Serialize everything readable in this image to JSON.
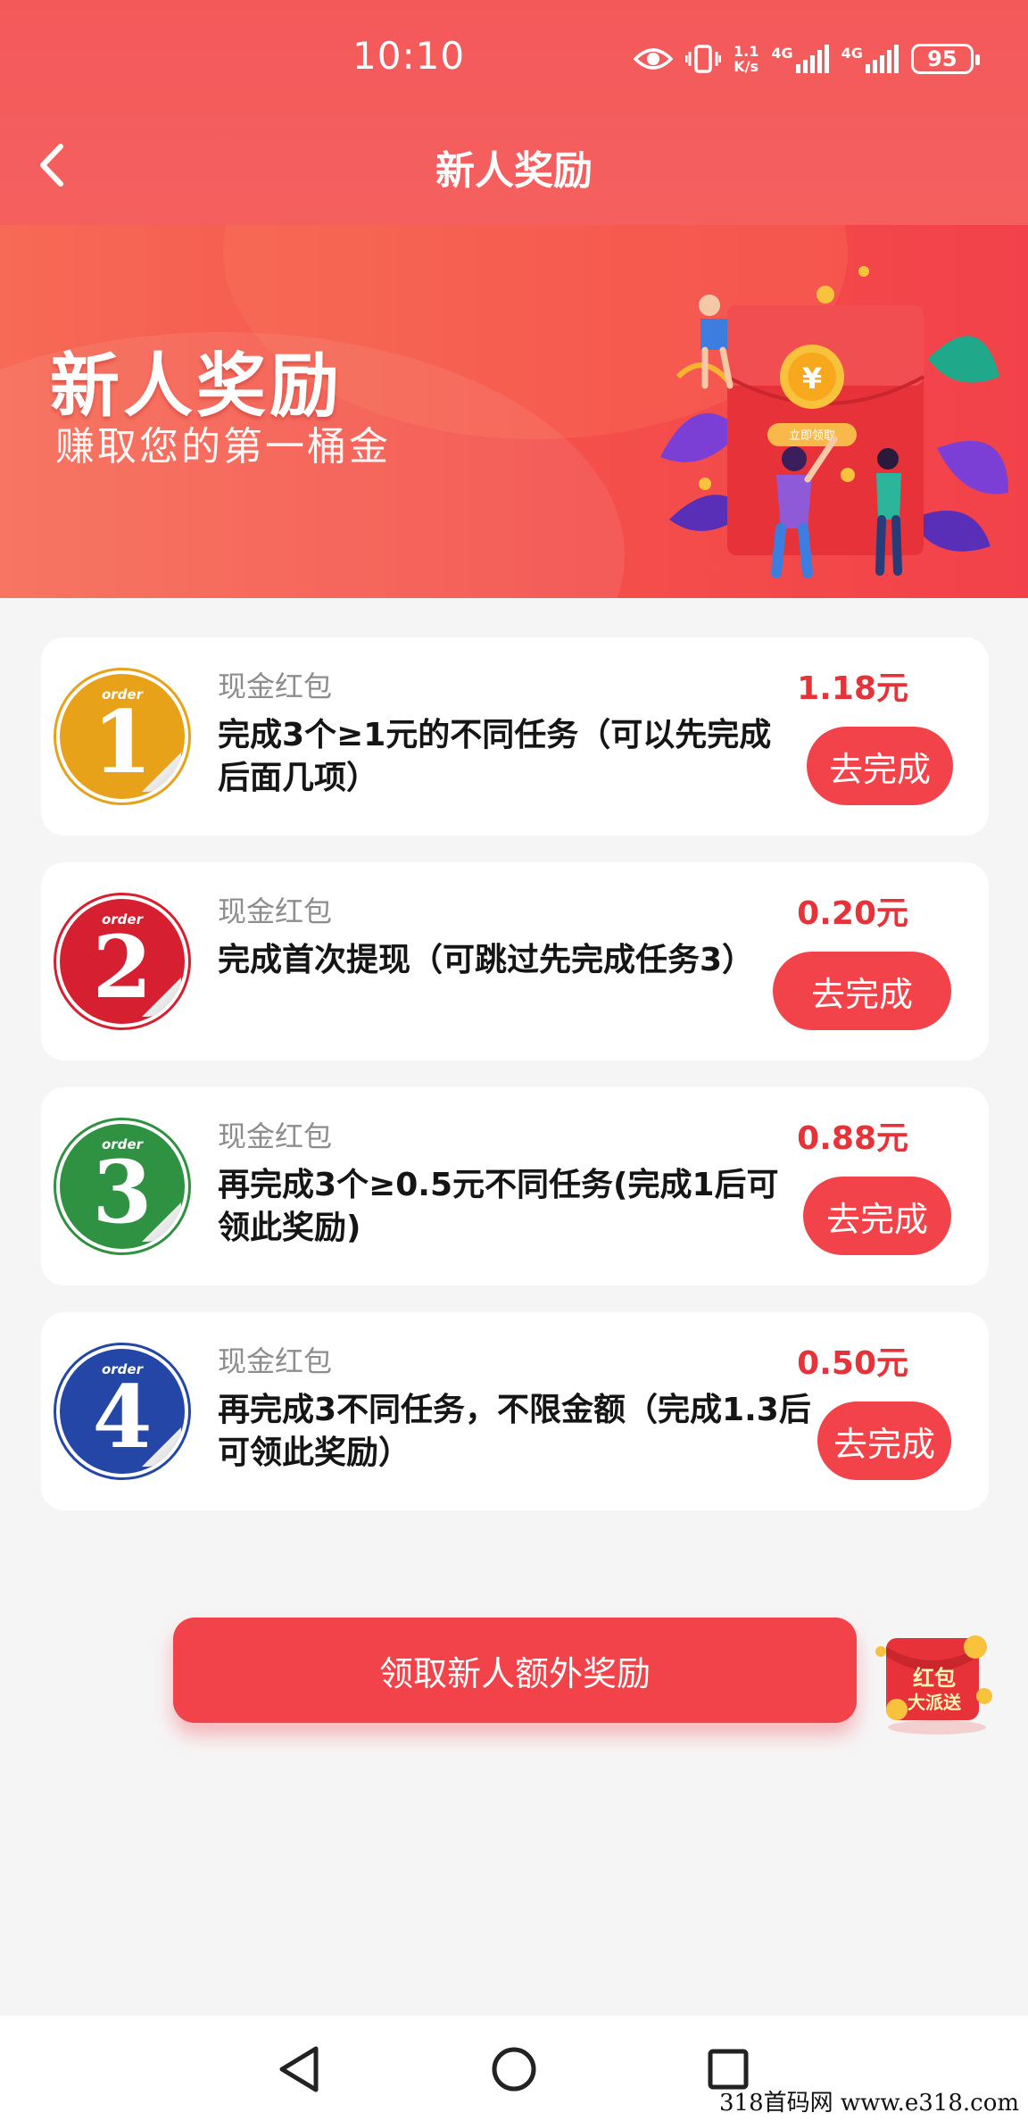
{
  "status_bar": {
    "time": "10:10",
    "net_speed_top": "1.1",
    "net_speed_bottom": "K/s",
    "signal1_label": "4G",
    "signal2_label": "4G",
    "battery": "95"
  },
  "header": {
    "title": "新人奖励"
  },
  "banner": {
    "title": "新人奖励",
    "subtitle": "赚取您的第一桶金",
    "packet_button": "立即领取",
    "coin_symbol": "¥"
  },
  "tasks": [
    {
      "order_word": "order",
      "number": "1",
      "badge_color": "#e8a21a",
      "type": "现金红包",
      "description": "完成3个≥1元的不同任务（可以先完成后面几项）",
      "amount": "1.18元",
      "button": "去完成"
    },
    {
      "order_word": "order",
      "number": "2",
      "badge_color": "#d62032",
      "type": "现金红包",
      "description": "完成首次提现（可跳过先完成任务3）",
      "amount": "0.20元",
      "button": "去完成"
    },
    {
      "order_word": "order",
      "number": "3",
      "badge_color": "#2f9142",
      "type": "现金红包",
      "description": "再完成3个≥0.5元不同任务(完成1后可领此奖励)",
      "amount": "0.88元",
      "button": "去完成"
    },
    {
      "order_word": "order",
      "number": "4",
      "badge_color": "#2446a6",
      "type": "现金红包",
      "description": "再完成3不同任务，不限金额（完成1.3后可领此奖励）",
      "amount": "0.50元",
      "button": "去完成"
    }
  ],
  "extra_reward": {
    "label": "领取新人额外奖励",
    "packet_line1": "红包",
    "packet_line2": "大派送"
  },
  "watermark": "318首码网 www.e318.com",
  "colors": {
    "primary": "#f2434a",
    "header": "#f4595a",
    "amount": "#e8323a",
    "background": "#f6f5f6"
  }
}
